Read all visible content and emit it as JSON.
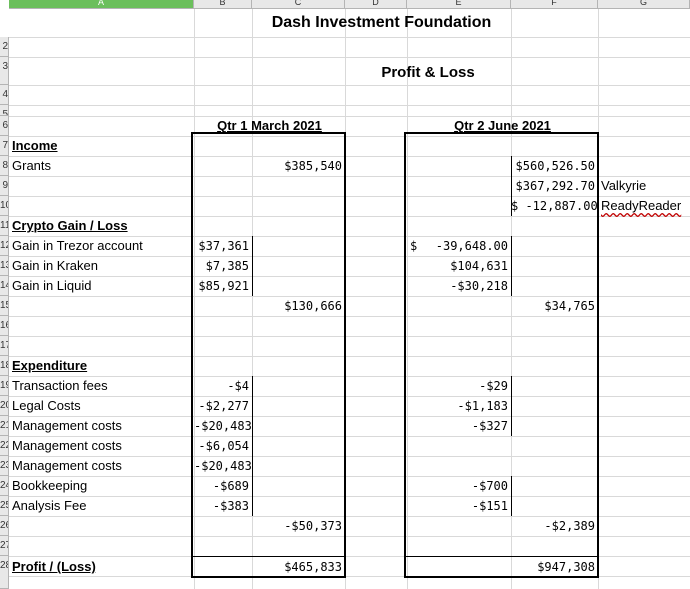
{
  "columns": [
    "A",
    "B",
    "C",
    "D",
    "E",
    "F",
    "G"
  ],
  "rows": [
    "2",
    "3",
    "4",
    "5",
    "6",
    "7",
    "8",
    "9",
    "10",
    "11",
    "12",
    "13",
    "14",
    "15",
    "16",
    "17",
    "18",
    "19",
    "20",
    "21",
    "22",
    "23",
    "24",
    "25",
    "26",
    "27",
    "28"
  ],
  "title": "Dash Investment Foundation",
  "subtitle": "Profit & Loss",
  "q1_header": "Qtr 1 March 2021",
  "q2_header": "Qtr 2 June 2021",
  "income": {
    "heading": "Income",
    "grants_label": "Grants",
    "q1_grants_total": "$385,540",
    "q2_grants": [
      "$560,526.50",
      "$367,292.70",
      "$ -12,887.00"
    ],
    "q2_grant_notes": [
      "",
      "Valkyrie",
      "ReadyReader"
    ]
  },
  "crypto": {
    "heading": "Crypto Gain / Loss",
    "items": [
      {
        "label": "Gain in Trezor account",
        "q1": "$37,361",
        "q2_prefix": "$",
        "q2": "-39,648.00"
      },
      {
        "label": "Gain in Kraken",
        "q1": "$7,385",
        "q2_prefix": "",
        "q2": "$104,631"
      },
      {
        "label": "Gain in Liquid",
        "q1": "$85,921",
        "q2_prefix": "",
        "q2": "-$30,218"
      }
    ],
    "q1_total": "$130,666",
    "q2_total": "$34,765"
  },
  "expenditure": {
    "heading": "Expenditure",
    "items": [
      {
        "label": "Transaction fees",
        "q1": "-$4",
        "q2": "-$29"
      },
      {
        "label": "Legal Costs",
        "q1": "-$2,277",
        "q2": "-$1,183"
      },
      {
        "label": "Management costs",
        "q1": "-$20,483",
        "q2": "-$327"
      },
      {
        "label": "Management costs",
        "q1": "-$6,054",
        "q2": ""
      },
      {
        "label": "Management costs",
        "q1": "-$20,483",
        "q2": ""
      },
      {
        "label": "Bookkeeping",
        "q1": "-$689",
        "q2": "-$700"
      },
      {
        "label": "Analysis Fee",
        "q1": "-$383",
        "q2": "-$151"
      }
    ],
    "q1_total": "-$50,373",
    "q2_total": "-$2,389"
  },
  "profit": {
    "label": "Profit / (Loss)",
    "q1": "$465,833",
    "q2": "$947,308"
  }
}
